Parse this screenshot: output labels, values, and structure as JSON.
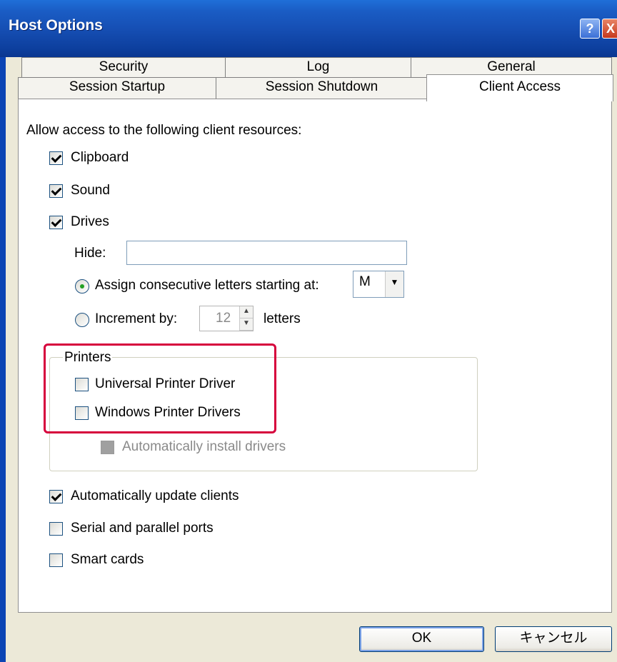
{
  "window": {
    "title": "Host Options"
  },
  "titlebar_buttons": {
    "help": "?",
    "close": "X"
  },
  "tabs": {
    "row_top": [
      "Security",
      "Log",
      "General"
    ],
    "row_bottom": [
      "Session Startup",
      "Session Shutdown"
    ],
    "active": "Client Access"
  },
  "client_access": {
    "intro": "Allow access to the following client resources:",
    "clipboard": {
      "label": "Clipboard",
      "checked": true
    },
    "sound": {
      "label": "Sound",
      "checked": true
    },
    "drives": {
      "label": "Drives",
      "checked": true
    },
    "hide": {
      "label": "Hide:",
      "value": ""
    },
    "assign": {
      "label": "Assign consecutive letters starting at:",
      "selected": true,
      "letter": "M"
    },
    "increment": {
      "label": "Increment by:",
      "selected": false,
      "value": "12",
      "suffix": "letters"
    },
    "printers": {
      "group_label": "Printers",
      "universal": {
        "label": "Universal Printer Driver",
        "checked": false
      },
      "windows": {
        "label": "Windows Printer Drivers",
        "checked": false
      },
      "auto_install": {
        "label": "Automatically install drivers",
        "checked": false,
        "disabled": true
      }
    },
    "auto_update": {
      "label": "Automatically update clients",
      "checked": true
    },
    "serial": {
      "label": "Serial and parallel ports",
      "checked": false
    },
    "smartcards": {
      "label": "Smart cards",
      "checked": false
    }
  },
  "buttons": {
    "ok": "OK",
    "cancel": "キャンセル"
  },
  "colors": {
    "highlight": "#d6003c",
    "titlebar": "#1a5cc4"
  }
}
